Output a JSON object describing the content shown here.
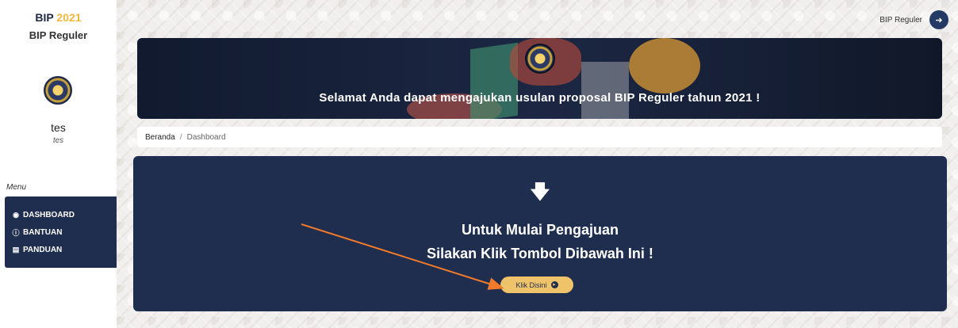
{
  "sidebar": {
    "brand": {
      "name": "BIP",
      "year": "2021"
    },
    "brand_sub": "BIP Reguler",
    "user": {
      "name": "tes",
      "sub": "tes"
    },
    "menu_label": "Menu",
    "items": [
      {
        "label": "DASHBOARD",
        "icon": "dashboard-icon"
      },
      {
        "label": "BANTUAN",
        "icon": "help-icon"
      },
      {
        "label": "PANDUAN",
        "icon": "book-icon"
      }
    ]
  },
  "topbar": {
    "user_label": "BIP Reguler",
    "logout_icon": "logout-icon"
  },
  "banner": {
    "text": "Selamat Anda dapat mengajukan usulan proposal BIP Reguler tahun 2021 !"
  },
  "breadcrumb": {
    "home": "Beranda",
    "separator": "/",
    "current": "Dashboard"
  },
  "cta": {
    "line1": "Untuk Mulai Pengajuan",
    "line2": "Silakan Klik Tombol Dibawah Ini !",
    "button_label": "Klik Disini"
  },
  "colors": {
    "navy": "#1f2d4f",
    "accent": "#eec36a",
    "year": "#f0b93a",
    "annotation_arrow": "#f07a2a"
  }
}
